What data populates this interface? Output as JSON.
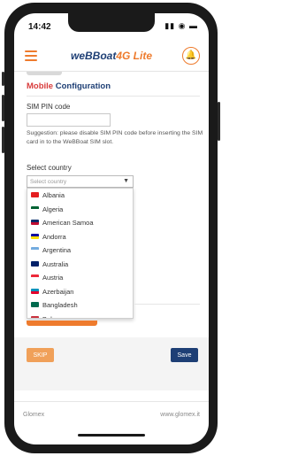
{
  "status_bar": {
    "time": "14:42",
    "icons": "▮▮ ◉ ▬"
  },
  "header": {
    "brand_prefix": "weBBoat",
    "brand_suffix": "4G Lite",
    "bell_glyph": "🔔"
  },
  "section": {
    "title_red": "Mobile",
    "title_blue": "Configuration"
  },
  "sim": {
    "label": "SIM PIN code",
    "value": "",
    "suggestion": "Suggestion: please disable SIM PIN code before inserting the SIM card in to the WeBBoat SIM slot."
  },
  "country": {
    "label": "Select country",
    "placeholder": "Select country",
    "options": [
      {
        "name": "Albania",
        "flag": [
          "#e41e20",
          "#e41e20"
        ]
      },
      {
        "name": "Algeria",
        "flag": [
          "#006233",
          "#ffffff"
        ]
      },
      {
        "name": "American Samoa",
        "flag": [
          "#002868",
          "#bf0a30"
        ]
      },
      {
        "name": "Andorra",
        "flag": [
          "#10069f",
          "#fedf00"
        ]
      },
      {
        "name": "Argentina",
        "flag": [
          "#74acdf",
          "#ffffff"
        ]
      },
      {
        "name": "Australia",
        "flag": [
          "#012169",
          "#012169"
        ]
      },
      {
        "name": "Austria",
        "flag": [
          "#ed2939",
          "#ffffff"
        ]
      },
      {
        "name": "Azerbaijan",
        "flag": [
          "#0092bc",
          "#e4002b"
        ]
      },
      {
        "name": "Bangladesh",
        "flag": [
          "#006a4e",
          "#006a4e"
        ]
      },
      {
        "name": "Belarus",
        "flag": [
          "#c8313e",
          "#4aa657"
        ]
      }
    ]
  },
  "actions": {
    "skip_label": "SKIP",
    "save_label": "Save"
  },
  "footer": {
    "left": "Glomex",
    "right": "www.glomex.it"
  },
  "colors": {
    "orange": "#ee7b2d",
    "navy": "#1e3f75",
    "red": "#d83b3b"
  }
}
